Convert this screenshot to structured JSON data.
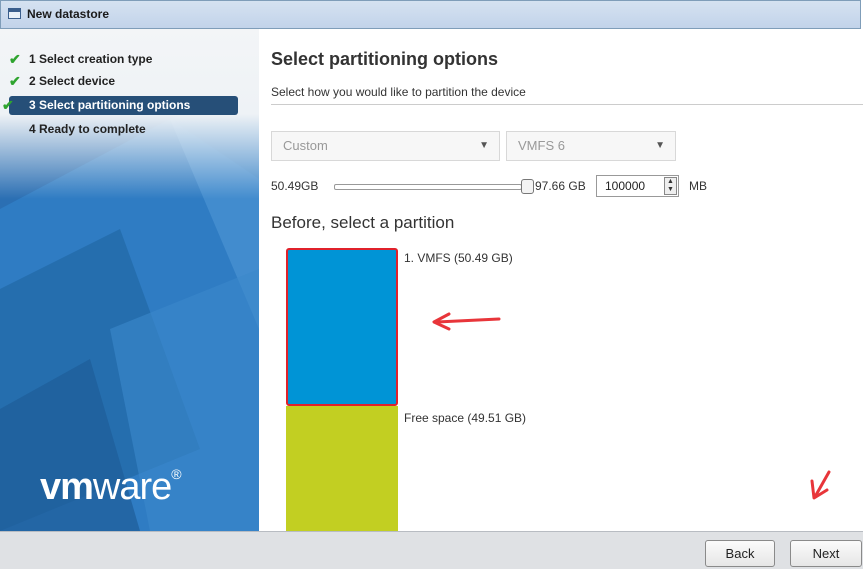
{
  "window": {
    "title": "New datastore"
  },
  "steps": [
    {
      "label": "1 Select creation type",
      "done": true
    },
    {
      "label": "2 Select device",
      "done": true
    },
    {
      "label": "3 Select partitioning options",
      "done": true,
      "active": true
    },
    {
      "label": "4 Ready to complete",
      "done": false
    }
  ],
  "logo": {
    "text_bold": "vm",
    "text_light": "ware",
    "mark": "®"
  },
  "main": {
    "title": "Select partitioning options",
    "subtitle": "Select how you would like to partition the device",
    "partition_select": {
      "value": "Custom"
    },
    "filesystem_select": {
      "value": "VMFS 6"
    },
    "size": {
      "min_label": "50.49GB",
      "max_label": "97.66 GB",
      "value": "100000",
      "unit": "MB",
      "slider_fraction": 1.0
    },
    "partition_heading": "Before, select a partition",
    "partitions": [
      {
        "label": "1. VMFS  (50.49 GB)",
        "color": "#0094d6",
        "selected": true
      },
      {
        "label": "Free space  (49.51 GB)",
        "color": "#c2cf22",
        "selected": false
      }
    ]
  },
  "footer": {
    "back_label": "Back",
    "next_label": "Next"
  },
  "colors": {
    "selected_border": "#e0212b",
    "annotation_arrow": "#e8353a"
  }
}
